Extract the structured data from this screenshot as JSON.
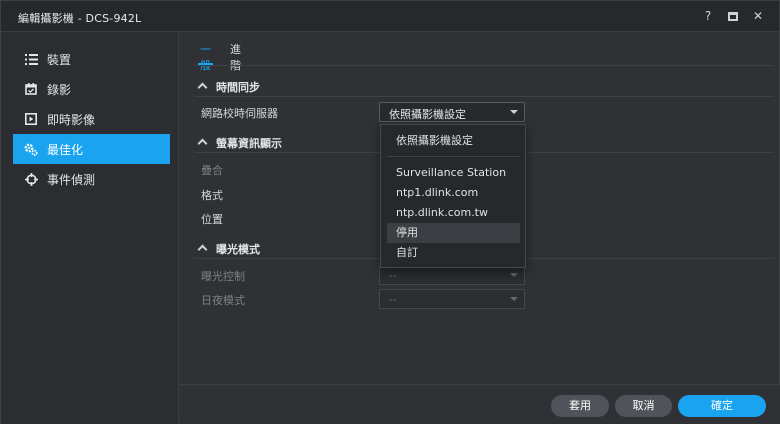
{
  "window": {
    "title": "編輯攝影機 - DCS-942L"
  },
  "titlebar": {
    "help_icon": "question-icon",
    "maximize_icon": "maximize-icon",
    "close_icon": "close-icon"
  },
  "sidebar": {
    "items": [
      {
        "label": "裝置",
        "icon": "list-icon"
      },
      {
        "label": "錄影",
        "icon": "calendar-icon"
      },
      {
        "label": "即時影像",
        "icon": "play-icon"
      },
      {
        "label": "最佳化",
        "icon": "gears-icon",
        "active": true
      },
      {
        "label": "事件偵測",
        "icon": "crosshair-icon"
      }
    ]
  },
  "tabs": [
    {
      "label": "一般",
      "active": true
    },
    {
      "label": "進階",
      "active": false
    }
  ],
  "sections": {
    "time_sync": {
      "title": "時間同步",
      "server_label": "網路校時伺服器",
      "server_value": "依照攝影機設定"
    },
    "osd": {
      "title": "螢幕資訊顯示",
      "overlay_label": "疊合",
      "format_label": "格式",
      "position_label": "位置"
    },
    "exposure": {
      "title": "曝光模式",
      "control_label": "曝光控制",
      "control_value": "--",
      "daynight_label": "日夜模式",
      "daynight_value": "--"
    }
  },
  "dropdown": {
    "options": [
      "依照攝影機設定",
      "Surveillance Station",
      "ntp1.dlink.com",
      "ntp.dlink.com.tw",
      "停用",
      "自訂"
    ],
    "hovered": "停用"
  },
  "footer": {
    "apply_label": "套用",
    "cancel_label": "取消",
    "ok_label": "確定"
  },
  "colors": {
    "accent": "#1aa3ef",
    "background": "#2f3134"
  }
}
